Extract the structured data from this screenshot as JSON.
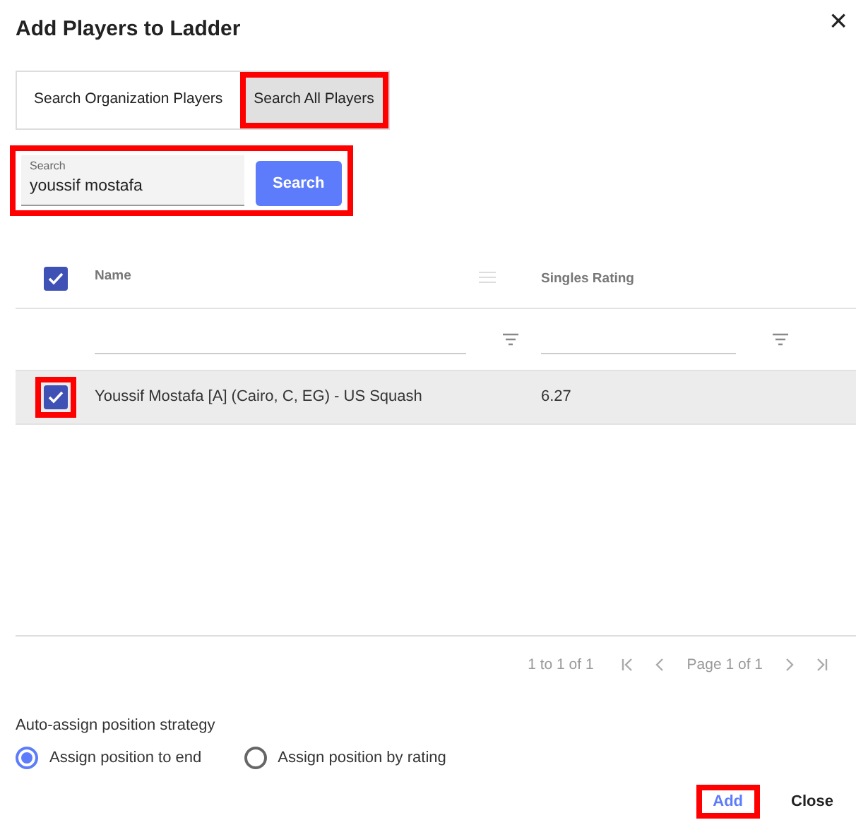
{
  "dialog": {
    "title": "Add Players to Ladder",
    "close": "×"
  },
  "tabs": [
    {
      "label": "Search Organization Players",
      "selected": false,
      "highlighted": false
    },
    {
      "label": "Search All Players",
      "selected": true,
      "highlighted": true
    }
  ],
  "search": {
    "label": "Search",
    "value": "youssif mostafa",
    "button": "Search",
    "highlighted": true
  },
  "table": {
    "select_all": {
      "checked": true
    },
    "columns": [
      {
        "label": "Name"
      },
      {
        "label": "Singles Rating"
      }
    ],
    "rows": [
      {
        "checked": true,
        "highlighted": true,
        "selected": true,
        "cells": [
          "Youssif Mostafa [A] (Cairo, C, EG) - US Squash",
          "6.27"
        ]
      }
    ]
  },
  "pagination": {
    "summary": "1 to 1 of 1",
    "page": "Page 1 of 1"
  },
  "strategy": {
    "label": "Auto-assign position strategy",
    "options": [
      {
        "label": "Assign position to end",
        "selected": true
      },
      {
        "label": "Assign position by rating",
        "selected": false
      }
    ]
  },
  "buttons": [
    {
      "label": "Add",
      "kind": "primary",
      "highlighted": true
    },
    {
      "label": "Close",
      "kind": "plain",
      "highlighted": false
    }
  ]
}
